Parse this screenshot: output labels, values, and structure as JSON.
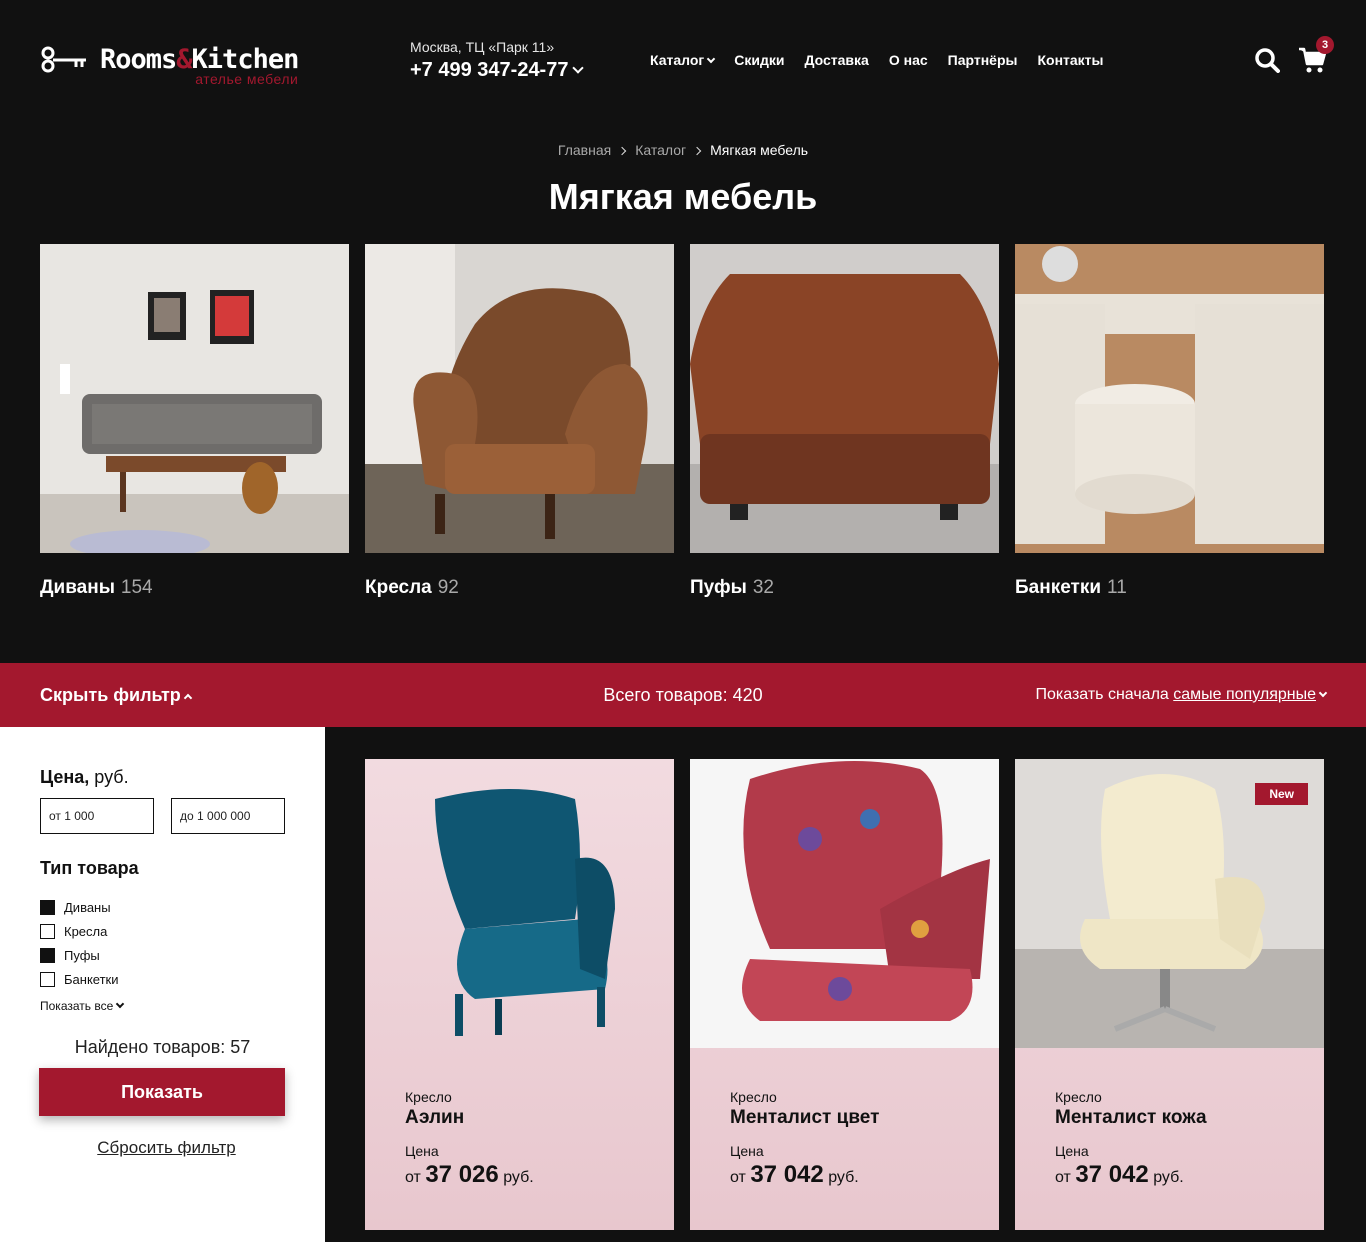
{
  "header": {
    "logo_main_left": "Rooms",
    "logo_amp": "&",
    "logo_main_right": "Kitchen",
    "logo_sub": "ателье мебели",
    "address": "Москва, ТЦ «Парк 11»",
    "phone": "+7 499 347-24-77",
    "nav": [
      "Каталог",
      "Скидки",
      "Доставка",
      "О нас",
      "Партнёры",
      "Контакты"
    ],
    "cart_count": "3"
  },
  "breadcrumb": [
    "Главная",
    "Каталог",
    "Мягкая мебель"
  ],
  "page_title": "Мягкая мебель",
  "categories": [
    {
      "name": "Диваны",
      "count": "154"
    },
    {
      "name": "Кресла",
      "count": "92"
    },
    {
      "name": "Пуфы",
      "count": "32"
    },
    {
      "name": "Банкетки",
      "count": "11"
    }
  ],
  "filter_bar": {
    "hide_filter": "Скрыть фильтр",
    "total": "Всего товаров: 420",
    "sort_prefix": "Показать сначала",
    "sort_value": "самые популярные"
  },
  "filter": {
    "price_label": "Цена,",
    "price_unit": "руб.",
    "price_from_placeholder": "от 1 000",
    "price_to_placeholder": "до 1 000 000",
    "type_label": "Тип товара",
    "types": [
      {
        "label": "Диваны",
        "checked": true
      },
      {
        "label": "Кресла",
        "checked": false
      },
      {
        "label": "Пуфы",
        "checked": true
      },
      {
        "label": "Банкетки",
        "checked": false
      }
    ],
    "show_all": "Показать все",
    "found": "Найдено товаров: 57",
    "show_button": "Показать",
    "reset": "Сбросить фильтр"
  },
  "products": [
    {
      "kind": "Кресло",
      "name": "Аэлин",
      "price_label": "Цена",
      "price_from": "от",
      "price": "37 026",
      "currency": "руб.",
      "badge": ""
    },
    {
      "kind": "Кресло",
      "name": "Менталист цвет",
      "price_label": "Цена",
      "price_from": "от",
      "price": "37 042",
      "currency": "руб.",
      "badge": ""
    },
    {
      "kind": "Кресло",
      "name": "Менталист кожа",
      "price_label": "Цена",
      "price_from": "от",
      "price": "37 042",
      "currency": "руб.",
      "badge": "New"
    }
  ],
  "colors": {
    "accent": "#a3182e",
    "background": "#111111",
    "product_bg": "#f2dbe0"
  }
}
